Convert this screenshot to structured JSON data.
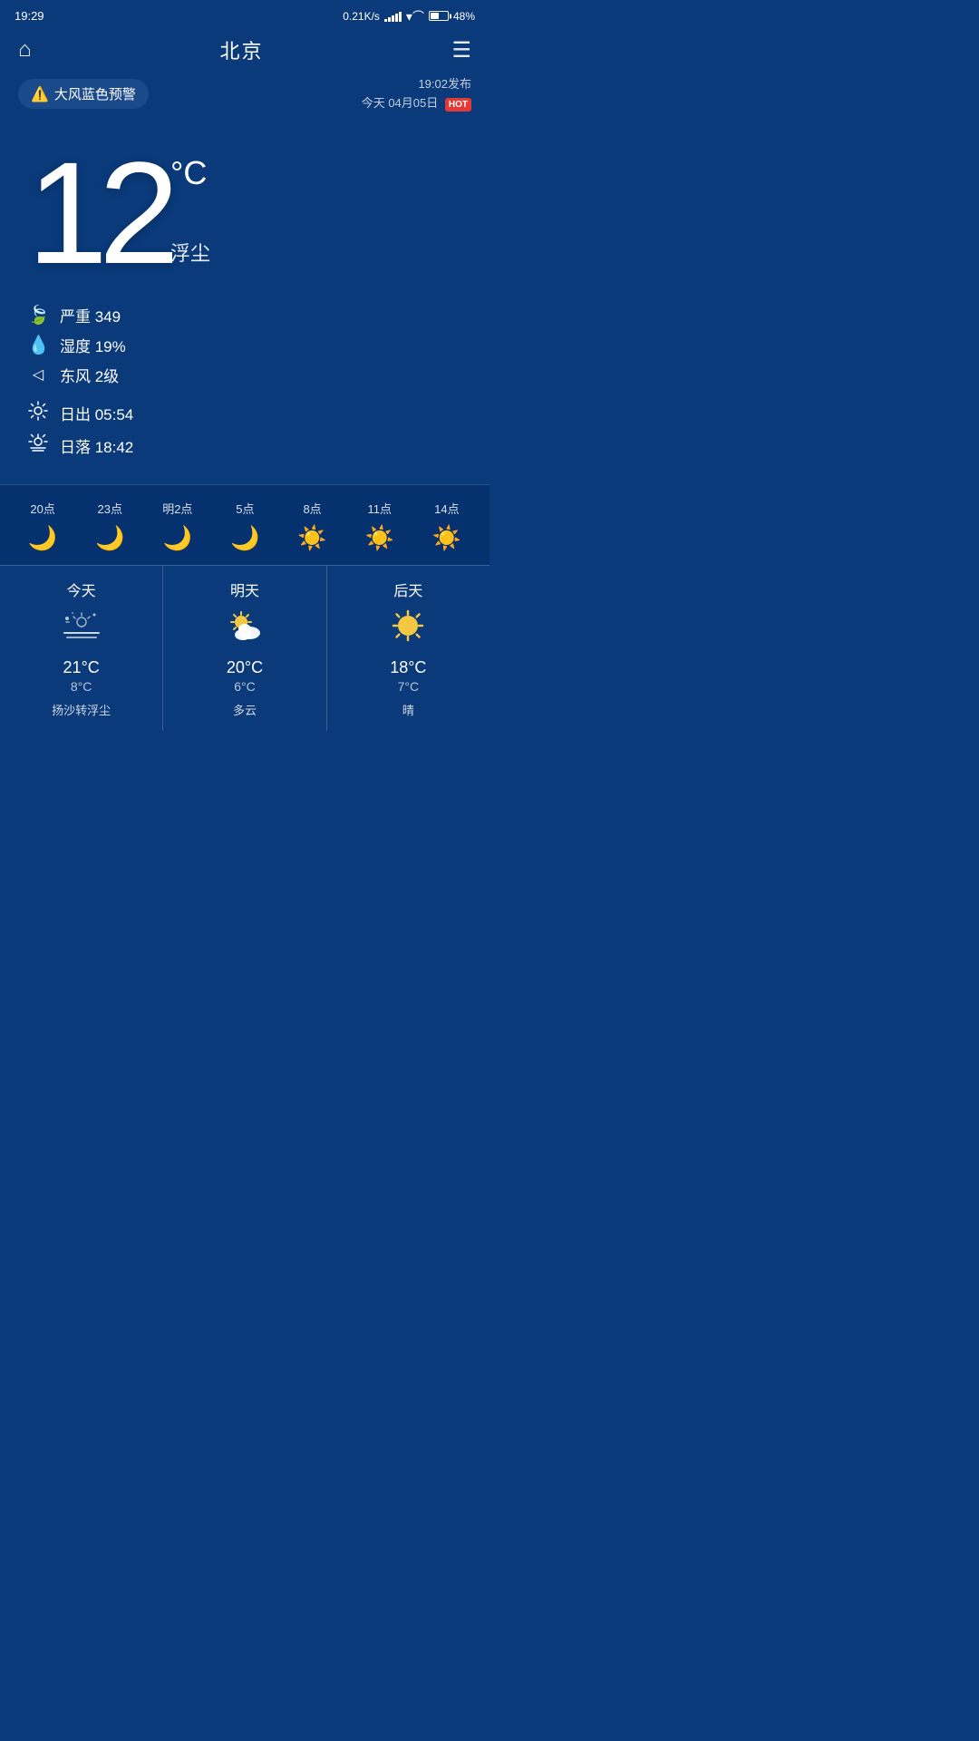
{
  "statusBar": {
    "time": "19:29",
    "network": "0.21K/s",
    "battery": "48%"
  },
  "nav": {
    "homeIcon": "⌂",
    "title": "北京",
    "menuIcon": "☰"
  },
  "alert": {
    "icon": "⚠️",
    "text": "大风蓝色预警",
    "publishTime": "19:02发布",
    "date": "今天 04月05日",
    "hotBadge": "HOT"
  },
  "current": {
    "temperature": "12",
    "unit": "°C",
    "weatherDesc": "浮尘",
    "aqi": {
      "icon": "🍃",
      "label": "严重 349"
    },
    "humidity": {
      "icon": "💧",
      "label": "湿度 19%"
    },
    "wind": {
      "icon": "◁",
      "label": "东风 2级"
    },
    "sunrise": {
      "label": "日出  05:54"
    },
    "sunset": {
      "label": "日落  18:42"
    }
  },
  "hourly": [
    {
      "time": "20点",
      "icon": "moon"
    },
    {
      "time": "23点",
      "icon": "moon"
    },
    {
      "time": "明2点",
      "icon": "moon"
    },
    {
      "time": "5点",
      "icon": "moon"
    },
    {
      "time": "8点",
      "icon": "sun"
    },
    {
      "time": "11点",
      "icon": "sun"
    },
    {
      "time": "14点",
      "icon": "sun"
    }
  ],
  "daily": [
    {
      "label": "今天",
      "icon": "dusty",
      "high": "21°C",
      "low": "8°C",
      "desc": "扬沙转浮尘"
    },
    {
      "label": "明天",
      "icon": "partly-cloudy",
      "high": "20°C",
      "low": "6°C",
      "desc": "多云"
    },
    {
      "label": "后天",
      "icon": "sunny",
      "high": "18°C",
      "low": "7°C",
      "desc": "晴"
    }
  ]
}
